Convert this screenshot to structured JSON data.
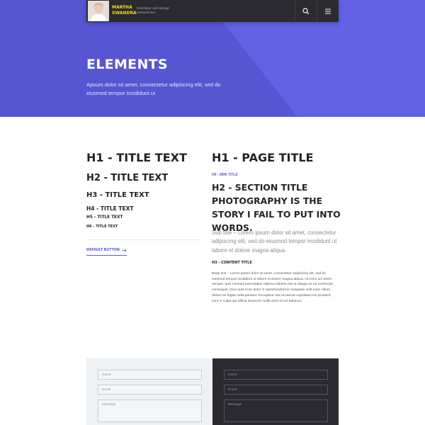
{
  "header": {
    "name": "MARTHA SWANDRA",
    "tagline": "Developer and Startup entrepreneur",
    "search_icon": "search-icon",
    "menu_icon": "hamburger-menu-icon"
  },
  "hero": {
    "title": "ELEMENTS",
    "text": "Apsum dolor sit amet, consectetur adipiscing elit, sed do eiusmod tempor incididunt ut"
  },
  "left": {
    "h1": "H1 - TITLE TEXT",
    "h2": "H2 - TITLE TEXT",
    "h3": "H3 - TITLE TEXT",
    "h4": "H4 - TITLE TEXT",
    "h5": "H5 - TITLE TEXT",
    "h6": "H6 - TITLE TEXT",
    "button_label": "DEFAULT BUTTON",
    "button_icon": "arrow-right-icon"
  },
  "right": {
    "page_title": "H1 - PAGE TITLE",
    "mini_title": "H6 - MINI TITLE",
    "section_title": "H2 - SECTION TITLE PHOTOGRAPHY IS THE STORY I FAIL TO PUT INTO WORDS.",
    "subtitle": "Sub title – Lorem ipsum dolor sit amet, consectetur adipiscing elit, sed do eiusmod tempor incididunt ut labore et dolore magna aliqua.",
    "content_title": "H3 - CONTENT TITLE",
    "body_text": "Body text – Lorem ipsum dolor sit amet, consectetur adipiscing elit, sed do eiusmod tempor incididunt ut labore et dolore magna aliqua. Ut enim ad minim veniam, quis nostrud exercitation ullamco laboris nisi ut aliquip ex ea commodo consequat. Duis aute irure dolor in reprehenderit in voluptate velit esse cillum dolore eu fugiat nulla pariatur. Excepteur sint occaecat cupidatat non proident, sunt in culpa qui officia deserunt mollit anim id est laborum."
  },
  "form_light": {
    "name": "Name",
    "email": "Email",
    "message": "Message"
  },
  "form_dark": {
    "name": "Name",
    "email": "Email",
    "message": "Message"
  },
  "colors": {
    "accent": "#5b5bd6",
    "dark": "#2b2a30",
    "brand_yellow": "#f5d72a"
  }
}
